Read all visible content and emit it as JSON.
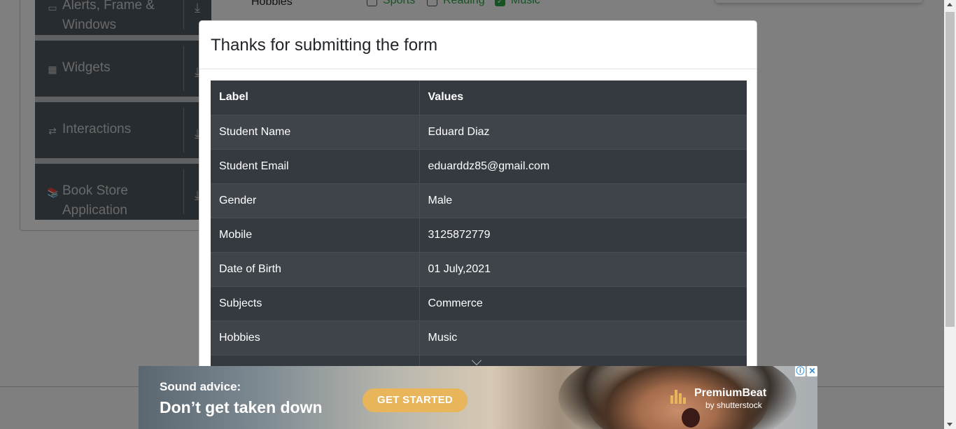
{
  "sidebar": {
    "groups": [
      {
        "label_line1": "Alerts, Frame &",
        "label_line2": "Windows",
        "icon": "window-icon"
      },
      {
        "label_line1": "Widgets",
        "label_line2": "",
        "icon": "widgets-icon"
      },
      {
        "label_line1": "Interactions",
        "label_line2": "",
        "icon": "interactions-icon"
      },
      {
        "label_line1": "Book Store",
        "label_line2": "Application",
        "icon": "books-icon"
      }
    ]
  },
  "form": {
    "hobbies_label": "Hobbies",
    "hobbies": [
      {
        "label": "Sports",
        "checked": false
      },
      {
        "label": "Reading",
        "checked": false
      },
      {
        "label": "Music",
        "checked": true
      }
    ]
  },
  "modal": {
    "title": "Thanks for submitting the form",
    "table": {
      "headers": [
        "Label",
        "Values"
      ],
      "rows": [
        [
          "Student Name",
          "Eduard Diaz"
        ],
        [
          "Student Email",
          "eduarddz85@gmail.com"
        ],
        [
          "Gender",
          "Male"
        ],
        [
          "Mobile",
          "3125872779"
        ],
        [
          "Date of Birth",
          "01 July,2021"
        ],
        [
          "Subjects",
          "Commerce"
        ],
        [
          "Hobbies",
          "Music"
        ]
      ]
    }
  },
  "ad": {
    "headline1": "Sound advice:",
    "headline2": "Don’t get taken down",
    "cta": "GET STARTED",
    "brand_name": "PremiumBeat",
    "brand_by": "by shutterstock",
    "info_icon": "ⓘ",
    "close_icon": "✕"
  },
  "colors": {
    "table_dark": "#343a40",
    "table_striped": "#3e444a",
    "sidebar_group": "#4e5861",
    "accent_green": "#28a745",
    "cta_gold": "#e8b55a"
  }
}
